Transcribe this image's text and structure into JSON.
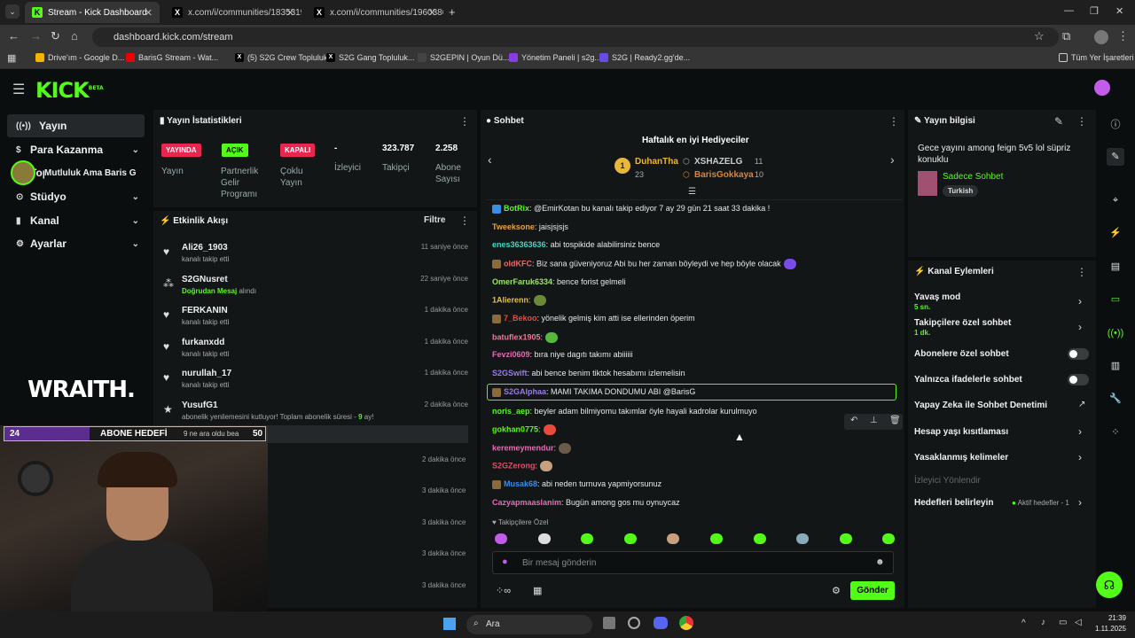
{
  "browser": {
    "tabs": [
      {
        "label": "Stream - Kick Dashboard",
        "active": true
      },
      {
        "label": "x.com/i/communities/18353197",
        "active": false
      },
      {
        "label": "x.com/i/communities/19603866",
        "active": false
      }
    ],
    "url": "dashboard.kick.com/stream",
    "bookmarks": [
      "Drive'ım - Google D...",
      "BarisG Stream - Wat...",
      "(5) S2G Crew Topluluk...",
      "S2G Gang Topluluk...",
      "S2GEPIN | Oyun Dü...",
      "Yönetim Paneli | s2g...",
      "S2G | Ready2.gg'de..."
    ],
    "all_bookmarks": "Tüm Yer İşaretleri"
  },
  "header": {
    "logo": "KICK",
    "logo_badge": "BETA"
  },
  "sidebar": {
    "items": [
      {
        "label": "Yayın",
        "icon": "radio-icon"
      },
      {
        "label": "Para Kazanma",
        "icon": "dollar-icon"
      },
      {
        "label": "Topluluk",
        "icon": "people-icon"
      },
      {
        "label": "Stüdyo",
        "icon": "studio-icon"
      },
      {
        "label": "Kanal",
        "icon": "channel-icon"
      },
      {
        "label": "Ayarlar",
        "icon": "gear-icon"
      }
    ],
    "overlay_name": "Mutluluk Ama Baris G"
  },
  "stats": {
    "title": "Yayın İstatistikleri",
    "items": [
      {
        "badge": "YAYINDA",
        "label": "Yayın",
        "color": "#e8264f"
      },
      {
        "badge": "AÇIK",
        "label": "Partnerlik Gelir Programı",
        "color": "#53fc18"
      },
      {
        "badge": "KAPALI",
        "label": "Çoklu Yayın",
        "color": "#e8264f"
      },
      {
        "value": "-",
        "label": "İzleyici"
      },
      {
        "value": "323.787",
        "label": "Takipçi"
      },
      {
        "value": "2.258",
        "label": "Abone Sayısı"
      }
    ]
  },
  "activity": {
    "title": "Etkinlik Akışı",
    "filter": "Filtre",
    "rows": [
      {
        "name": "Ali26_1903",
        "sub": "kanalı takip etti",
        "time": "11 saniye önce"
      },
      {
        "name": "S2GNusret",
        "sub_hl": "Doğrudan Mesaj",
        "sub": "alındı",
        "time": "22 saniye önce"
      },
      {
        "name": "FERKANIN",
        "sub": "kanalı takip etti",
        "time": "1 dakika önce"
      },
      {
        "name": "furkanxdd",
        "sub": "kanalı takip etti",
        "time": "1 dakika önce"
      },
      {
        "name": "nurullah_17",
        "sub": "kanalı takip etti",
        "time": "1 dakika önce"
      },
      {
        "name": "YusufG1",
        "sub": "abonelik yenilemesini kutluyor! Toplam abonelik süresi -",
        "sub_hl2": "9",
        "sub2": "ay!",
        "time": "2 dakika önce"
      }
    ],
    "more_times": [
      "2 dakika önce",
      "3 dakika önce",
      "3 dakika önce",
      "3 dakika önce",
      "3 dakika önce"
    ]
  },
  "overlay": {
    "sub_goal_current": "24",
    "sub_goal_label": "ABONE HEDEFİ",
    "sub_goal_msg": "9 ne ara oldu bea",
    "sub_goal_target": "50",
    "sponsor": "WRAITH."
  },
  "chat": {
    "title": "Sohbet",
    "gifters_title": "Haftalık en iyi Hediyeciler",
    "gifters": [
      {
        "name": "DuhanTha",
        "count": "23"
      },
      {
        "name": "XSHAZELG",
        "count": "11"
      },
      {
        "name": "BarisGokkaya",
        "count": "10"
      }
    ],
    "messages": [
      {
        "user": "BotRix",
        "color": "#53fc18",
        "text": ": @EmirKotan bu kanalı takip ediyor 7 ay 29 gün 21 saat 33 dakika !"
      },
      {
        "user": "Tweeksone",
        "color": "#e8a33b",
        "text": ": jaisjsjsjs"
      },
      {
        "user": "enes36363636",
        "color": "#3bd9c5",
        "text": ": abi tospikide alabilirsiniz bence"
      },
      {
        "user": "oldKFC",
        "color": "#e86a6a",
        "text": ": Biz sana güveniyoruz Abi bu her zaman böyleydi ve hep böyle olacak"
      },
      {
        "user": "OmerFaruk6334",
        "color": "#9be85b",
        "text": ": bence forist gelmeli"
      },
      {
        "user": "1Alierenn",
        "color": "#e8c03b",
        "text": ":"
      },
      {
        "user": "7_Bekoo",
        "color": "#e84b3b",
        "text": ": yönelik gelmiş kim atti ise ellerinden öperim"
      },
      {
        "user": "batuflex1905",
        "color": "#e87a9a",
        "text": ":"
      },
      {
        "user": "Fevzi0609",
        "color": "#e86ab5",
        "text": ": bıra niye dagıtı takımı abiiiiii"
      },
      {
        "user": "S2GSwift",
        "color": "#9a7be8",
        "text": ": abi bence benim tiktok hesabımı izlemelisin"
      },
      {
        "user": "S2GAlphaa",
        "color": "#9a7be8",
        "text": ": MAMI TAKIMA DONDUMU ABI @BarisG"
      },
      {
        "user": "noris_aep",
        "color": "#53fc18",
        "text": ": beyler adam bilmiyomu takımlar öyle hayali kadrolar kurulmuyo"
      },
      {
        "user": "gokhan0775",
        "color": "#53fc18",
        "text": ":"
      },
      {
        "user": "keremeymendur",
        "color": "#e86ab5",
        "text": ":"
      },
      {
        "user": "S2GZerong",
        "color": "#e84b6a",
        "text": ":"
      },
      {
        "user": "Musak68",
        "color": "#3b8de8",
        "text": ": abi neden turnuva yapmiyorsunuz"
      },
      {
        "user": "Cazyapmaaslanim",
        "color": "#e86ab5",
        "text": ": Bugün among gos mu oynuycaz"
      }
    ],
    "followers_only": "Takipçilere Özel",
    "input_placeholder": "Bir mesaj gönderin",
    "send_label": "Gönder"
  },
  "stream_info": {
    "title": "Yayın bilgisi",
    "stream_title": "Gece yayını among feign 5v5 lol süpriz konuklu",
    "category": "Sadece Sohbet",
    "tag": "Turkish"
  },
  "channel_actions": {
    "title": "Kanal Eylemleri",
    "slow_mode": "Yavaş mod",
    "slow_mode_val": "5 sn.",
    "followers_chat": "Takipçilere özel sohbet",
    "followers_chat_val": "1 dk.",
    "subs_chat": "Abonelere özel sohbet",
    "emote_chat": "Yalnızca ifadelerle sohbet",
    "ai_mod": "Yapay Zeka ile Sohbet Denetimi",
    "account_age": "Hesap yaşı kısıtlaması",
    "banned_words": "Yasaklanmış kelimeler",
    "viewer_redirect": "İzleyici Yönlendir",
    "set_goals": "Hedefleri belirleyin",
    "goals_status": "Aktif hedefler - 1"
  },
  "taskbar": {
    "search": "Ara",
    "time": "21:39",
    "date": "1.11.2025"
  }
}
